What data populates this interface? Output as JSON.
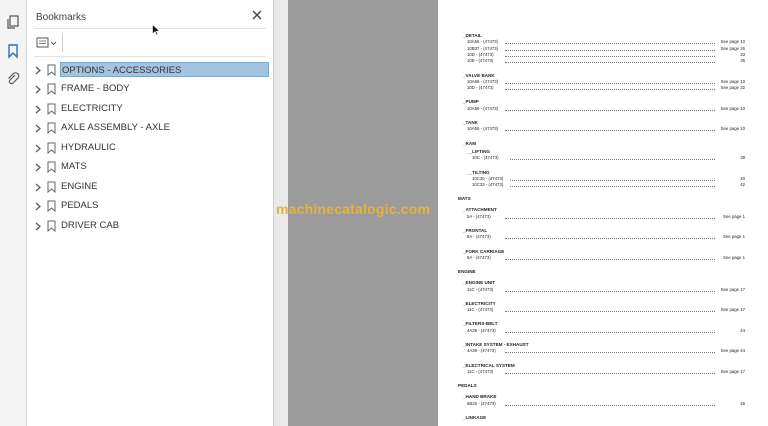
{
  "rail": {
    "icons": [
      "pages-icon",
      "bookmark-icon",
      "attachment-icon"
    ]
  },
  "bookmarks_panel": {
    "title": "Bookmarks",
    "items": [
      {
        "label": "OPTIONS - ACCESSORIES",
        "selected": true
      },
      {
        "label": "FRAME - BODY",
        "selected": false
      },
      {
        "label": "ELECTRICITY",
        "selected": false
      },
      {
        "label": "AXLE ASSEMBLY - AXLE",
        "selected": false
      },
      {
        "label": "HYDRAULIC",
        "selected": false
      },
      {
        "label": "MATS",
        "selected": false
      },
      {
        "label": "ENGINE",
        "selected": false
      },
      {
        "label": "PEDALS",
        "selected": false
      },
      {
        "label": "DRIVER CAB",
        "selected": false
      }
    ]
  },
  "watermark": "machinecatalogic.com",
  "document": {
    "lines": [
      {
        "kind": "sub",
        "text": "_DETAIL"
      },
      {
        "kind": "entry",
        "text": "10A56 - (47473)",
        "page": "See page 10"
      },
      {
        "kind": "entry",
        "text": "10B37 - (47473)",
        "page": "See page 26"
      },
      {
        "kind": "entry",
        "text": "10D - (47473)",
        "page": "33"
      },
      {
        "kind": "entry",
        "text": "10E - (47473)",
        "page": "35"
      },
      {
        "kind": "sub",
        "text": "_VALVE BANK"
      },
      {
        "kind": "entry",
        "text": "10A56 - (47473)",
        "page": "See page 10"
      },
      {
        "kind": "entry",
        "text": "10D - (47473)",
        "page": "See page 32"
      },
      {
        "kind": "sub",
        "text": "_PUMP"
      },
      {
        "kind": "entry",
        "text": "10A56 - (47473)",
        "page": "See page 10"
      },
      {
        "kind": "sub",
        "text": "_TANK"
      },
      {
        "kind": "entry",
        "text": "10A56 - (47473)",
        "page": "See page 10"
      },
      {
        "kind": "sub",
        "text": "_RAM"
      },
      {
        "kind": "subsub",
        "text": "__LIFTING"
      },
      {
        "kind": "entry2",
        "text": "10C - (47473)",
        "page": "38"
      },
      {
        "kind": "subsub",
        "text": "__TILTING"
      },
      {
        "kind": "entry2",
        "text": "10C30 - (47473)",
        "page": "40"
      },
      {
        "kind": "entry2",
        "text": "10C33 - (47473)",
        "page": "42"
      },
      {
        "kind": "section",
        "text": "MATS"
      },
      {
        "kind": "sub",
        "text": "_ATTACHMENT"
      },
      {
        "kind": "entry",
        "text": "5A - (47473)",
        "page": "See page 1"
      },
      {
        "kind": "sub",
        "text": "_FRONTAL"
      },
      {
        "kind": "entry",
        "text": "5A - (47473)",
        "page": "See page 1"
      },
      {
        "kind": "sub",
        "text": "_FORK CARRIAGE"
      },
      {
        "kind": "entry",
        "text": "5A - (47473)",
        "page": "See page 1"
      },
      {
        "kind": "section",
        "text": "ENGINE"
      },
      {
        "kind": "sub",
        "text": "_ENGINE UNIT"
      },
      {
        "kind": "entry",
        "text": "11C - (47473)",
        "page": "See page 17"
      },
      {
        "kind": "sub",
        "text": "_ELECTRICITY"
      },
      {
        "kind": "entry",
        "text": "11C - (47473)",
        "page": "See page 17"
      },
      {
        "kind": "sub",
        "text": "_FILTERS-BELT"
      },
      {
        "kind": "entry",
        "text": "4A39 - (47473)",
        "page": "44"
      },
      {
        "kind": "sub",
        "text": "_INTAKE SYSTEM - EXHAUST"
      },
      {
        "kind": "entry",
        "text": "4A39 - (47473)",
        "page": "See page 44"
      },
      {
        "kind": "sub",
        "text": "_ELECTRICAL SYSTEM"
      },
      {
        "kind": "entry",
        "text": "11C - (47473)",
        "page": "See page 17"
      },
      {
        "kind": "section",
        "text": "PEDALS"
      },
      {
        "kind": "sub",
        "text": "_HAND BRAKE"
      },
      {
        "kind": "entry",
        "text": "6B26 - (47473)",
        "page": "46"
      },
      {
        "kind": "sub",
        "text": "_LINKAGE"
      }
    ]
  }
}
